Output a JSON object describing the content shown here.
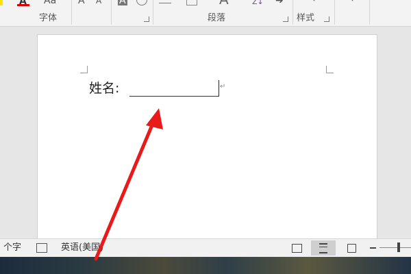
{
  "ribbon": {
    "groups": [
      {
        "label": "字体"
      },
      {
        "label": "段落"
      },
      {
        "label": "样式"
      }
    ],
    "icons": {
      "font_color": "A",
      "change_case": "Aa",
      "grow_font": "A",
      "shrink_font": "A",
      "highlight": "A",
      "styles_big": "A",
      "sort": "Z↓"
    }
  },
  "document": {
    "name_label": "姓名:"
  },
  "statusbar": {
    "word_count": "个字",
    "language": "英语(美国)"
  },
  "colors": {
    "arrow": "#e81a1a",
    "font_color_bar": "#e00000",
    "highlight_yellow": "#ffe600"
  }
}
